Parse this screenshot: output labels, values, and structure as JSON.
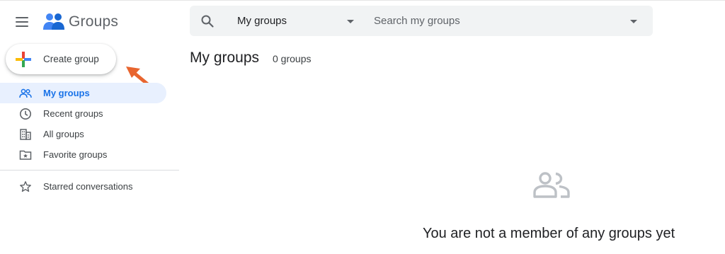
{
  "app": {
    "title": "Groups"
  },
  "sidebar": {
    "create_label": "Create group",
    "items": [
      {
        "label": "My groups",
        "icon": "people-icon",
        "active": true
      },
      {
        "label": "Recent groups",
        "icon": "clock-icon",
        "active": false
      },
      {
        "label": "All groups",
        "icon": "building-icon",
        "active": false
      },
      {
        "label": "Favorite groups",
        "icon": "star-folder-icon",
        "active": false
      }
    ],
    "starred_label": "Starred conversations"
  },
  "search": {
    "scope_value": "My groups",
    "placeholder": "Search my groups"
  },
  "main": {
    "title": "My groups",
    "count": "0 groups",
    "empty_message": "You are not a member of any groups yet"
  },
  "colors": {
    "accent": "#1a73e8",
    "active_bg": "#e8f0fe",
    "annotation_arrow": "#e8652f",
    "search_bg": "#f1f3f4"
  }
}
